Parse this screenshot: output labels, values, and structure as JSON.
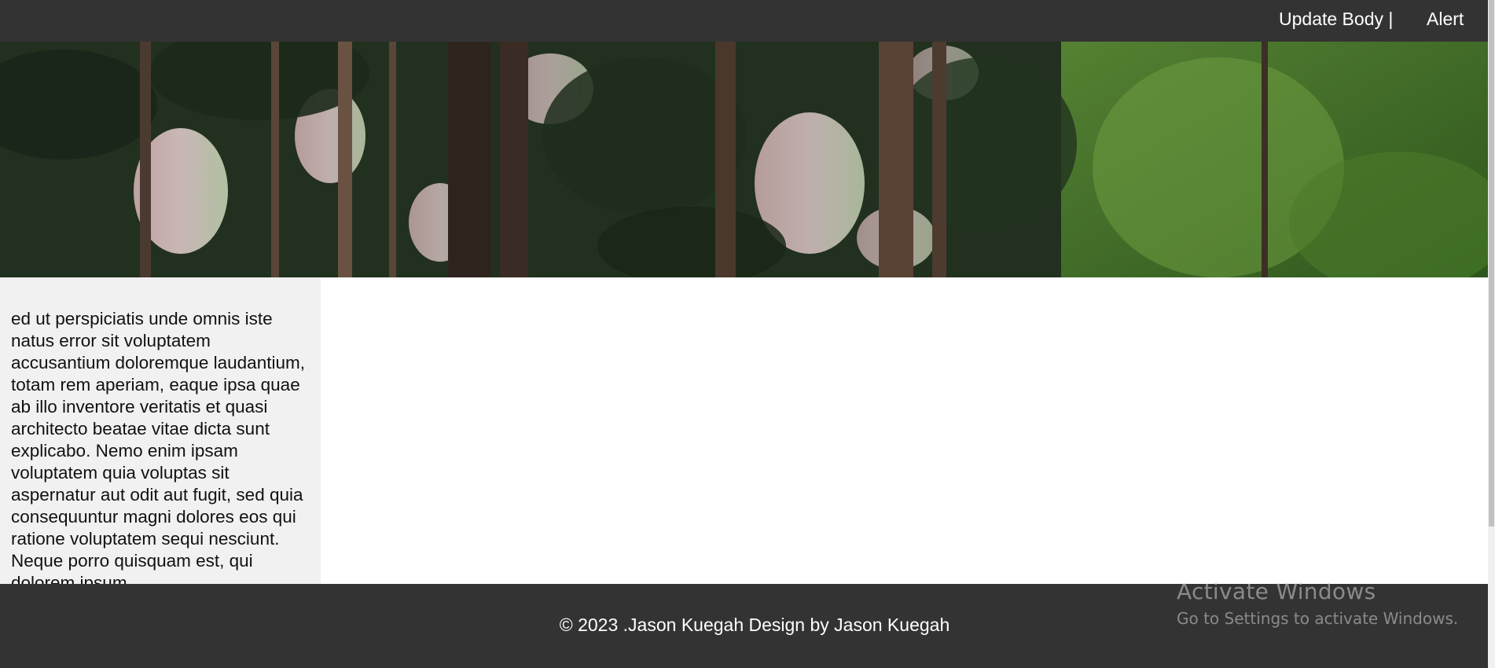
{
  "nav": {
    "update_body_label": "Update Body |",
    "alert_label": "Alert"
  },
  "hero": {
    "image_icon": "forest-hero-image"
  },
  "sidebar": {
    "text": "ed ut perspiciatis unde omnis iste natus error sit voluptatem accusantium doloremque laudantium, totam rem aperiam, eaque ipsa quae ab illo inventore veritatis et quasi architecto beatae vitae dicta sunt explicabo. Nemo enim ipsam voluptatem quia voluptas sit aspernatur aut odit aut fugit, sed quia consequuntur magni dolores eos qui ratione voluptatem sequi nesciunt. Neque porro quisquam est, qui dolorem ipsum"
  },
  "footer": {
    "copyright": "© 2023 .Jason Kuegah Design by Jason Kuegah"
  },
  "watermark": {
    "title": "Activate Windows",
    "subtitle": "Go to Settings to activate Windows."
  },
  "colors": {
    "bar": "#333333",
    "sidebar_bg": "#f1f1f1",
    "text_on_dark": "#ffffff"
  }
}
